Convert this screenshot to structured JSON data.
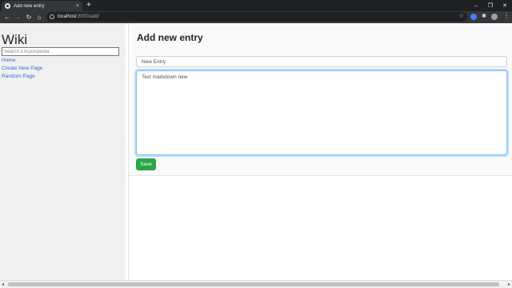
{
  "browser": {
    "tab_title": "Add new entry",
    "tab_close": "×",
    "new_tab": "+",
    "url_host": "localhost",
    "url_path": ":8000/add/",
    "controls": {
      "minimize": "–",
      "maximize": "❐",
      "close": "✕"
    },
    "nav": {
      "back": "←",
      "forward": "→",
      "reload": "↻",
      "home": "⌂"
    },
    "star": "☆",
    "menu": "⋮"
  },
  "sidebar": {
    "title": "Wiki",
    "search_placeholder": "Search Encyclopedia",
    "links": [
      "Home",
      "Create New Page",
      "Random Page"
    ]
  },
  "main": {
    "heading": "Add new entry",
    "title_value": "New Entry",
    "content_value": "Text markdown new",
    "save_label": "Save"
  },
  "colors": {
    "save_button": "#28a745",
    "link": "#2f73c9",
    "sidebar_bg": "#f0f0f0",
    "focus_border": "#80bdff"
  }
}
